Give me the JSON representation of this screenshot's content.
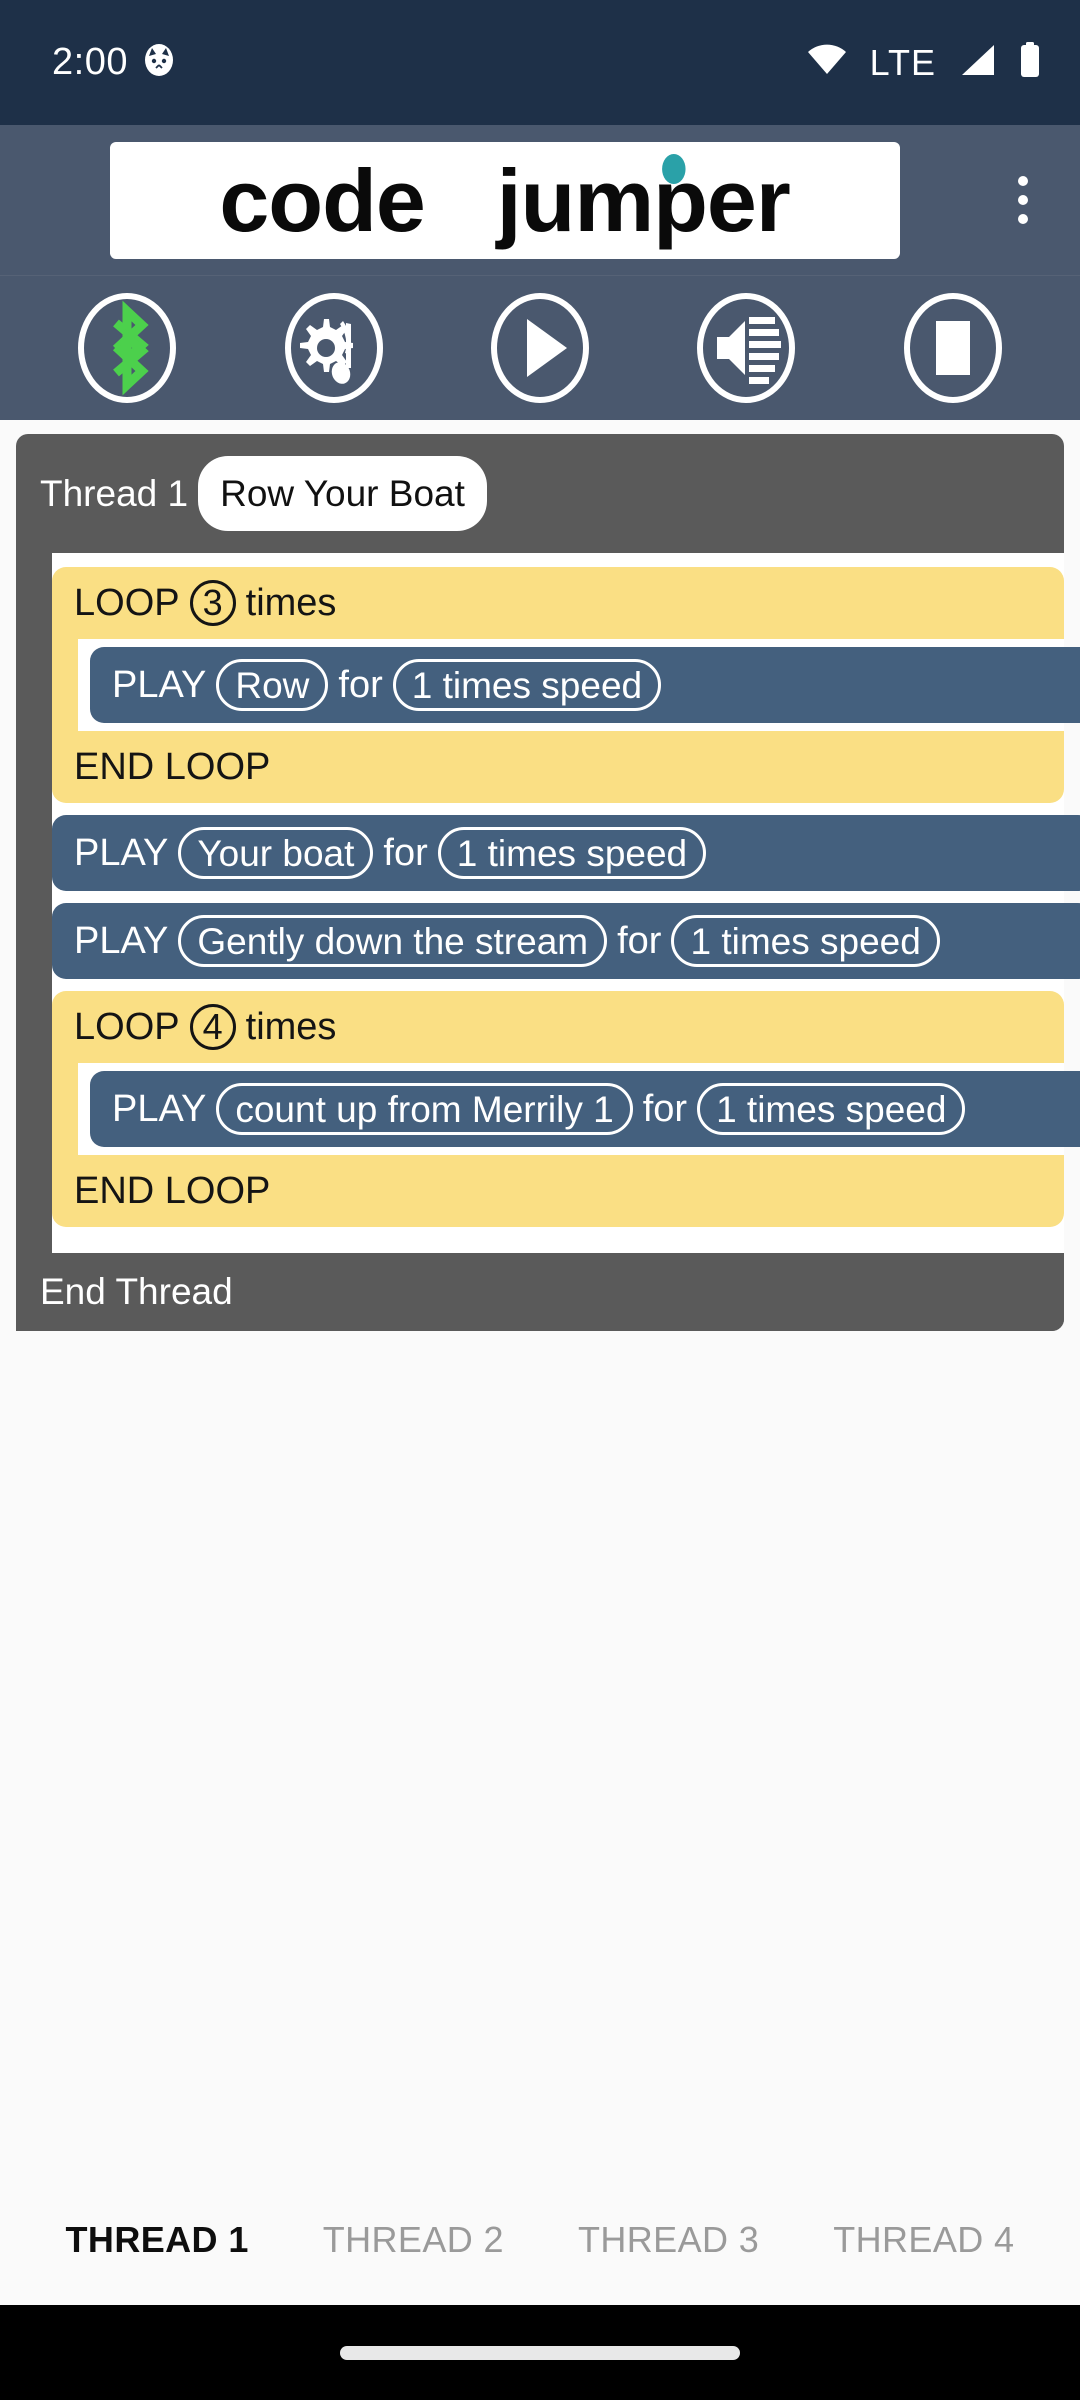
{
  "status_bar": {
    "clock": "2:00",
    "notification_icon": "cat-face-icon",
    "network_label": "LTE",
    "icons": [
      "wifi-icon",
      "lte-label",
      "cellular-signal-icon",
      "battery-icon"
    ],
    "background": "#1E3048"
  },
  "app_bar": {
    "logo_text_part1": "code",
    "logo_text_part2": "jumper",
    "logo_full": "code jumper",
    "accent_dot_color": "#2AA1A8",
    "overflow_menu": "more-options",
    "background": "#4A586E"
  },
  "toolbar": {
    "buttons": [
      {
        "name": "bluetooth-button",
        "icon": "bluetooth-icon",
        "color": "#4CD04C"
      },
      {
        "name": "sound-settings-button",
        "icon": "gear-music-note-icon",
        "color": "#FFFFFF"
      },
      {
        "name": "play-button",
        "icon": "play-icon",
        "color": "#FFFFFF"
      },
      {
        "name": "volume-button",
        "icon": "speaker-volume-icon",
        "color": "#FFFFFF"
      },
      {
        "name": "stop-button",
        "icon": "stop-icon",
        "color": "#FFFFFF"
      }
    ]
  },
  "thread": {
    "label": "Thread 1",
    "name": "Row Your Boat",
    "end_label": "End Thread",
    "container_color": "#5A5A5A"
  },
  "program": {
    "loop_color": "#FADF84",
    "play_color": "#44607E",
    "blocks": [
      {
        "type": "loop",
        "head_prefix": "LOOP",
        "count": "3",
        "head_suffix": "times",
        "end_label": "END LOOP",
        "children": [
          {
            "type": "play",
            "prefix": "PLAY",
            "sound": "Row",
            "middle": "for",
            "speed": "1 times speed"
          }
        ]
      },
      {
        "type": "play",
        "prefix": "PLAY",
        "sound": "Your boat",
        "middle": "for",
        "speed": "1 times speed"
      },
      {
        "type": "play",
        "prefix": "PLAY",
        "sound": "Gently down the stream",
        "middle": "for",
        "speed": "1 times speed"
      },
      {
        "type": "loop",
        "head_prefix": "LOOP",
        "count": "4",
        "head_suffix": "times",
        "end_label": "END LOOP",
        "children": [
          {
            "type": "play",
            "prefix": "PLAY",
            "sound": "count up from Merrily 1",
            "middle": "for",
            "speed": "1 times speed"
          }
        ]
      }
    ]
  },
  "tab_bar": {
    "tabs": [
      {
        "label": "THREAD 1",
        "active": true
      },
      {
        "label": "THREAD 2",
        "active": false
      },
      {
        "label": "THREAD 3",
        "active": false
      },
      {
        "label": "THREAD 4",
        "active": false
      }
    ]
  }
}
